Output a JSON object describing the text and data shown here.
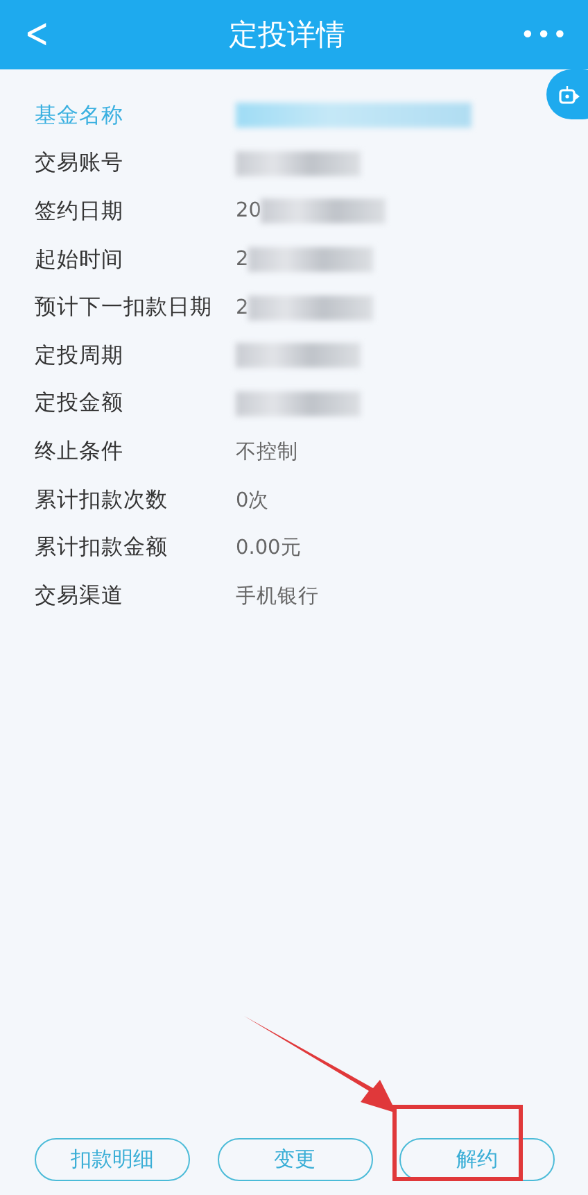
{
  "header": {
    "title": "定投详情",
    "back_icon": "<",
    "more_icon": "•••"
  },
  "rows": [
    {
      "label": "基金名称",
      "highlighted": true,
      "kind": "blurred"
    },
    {
      "label": "交易账号",
      "highlighted": false,
      "kind": "blurred"
    },
    {
      "label": "签约日期",
      "highlighted": false,
      "kind": "blurred",
      "value": "20"
    },
    {
      "label": "起始时间",
      "highlighted": false,
      "kind": "blurred",
      "value": "2"
    },
    {
      "label": "预计下一扣款日期",
      "highlighted": false,
      "kind": "blurred",
      "value": "2"
    },
    {
      "label": "定投周期",
      "highlighted": false,
      "kind": "blurred"
    },
    {
      "label": "定投金额",
      "highlighted": false,
      "kind": "blurred"
    },
    {
      "label": "终止条件",
      "highlighted": false,
      "kind": "text",
      "value": "不控制"
    },
    {
      "label": "累计扣款次数",
      "highlighted": false,
      "kind": "text",
      "value": "0次"
    },
    {
      "label": "累计扣款金额",
      "highlighted": false,
      "kind": "text",
      "value": "0.00元"
    },
    {
      "label": "交易渠道",
      "highlighted": false,
      "kind": "text",
      "value": "手机银行"
    }
  ],
  "buttons": [
    {
      "label": "扣款明细",
      "marked": false
    },
    {
      "label": "变更",
      "marked": false
    },
    {
      "label": "解约",
      "marked": true
    }
  ]
}
